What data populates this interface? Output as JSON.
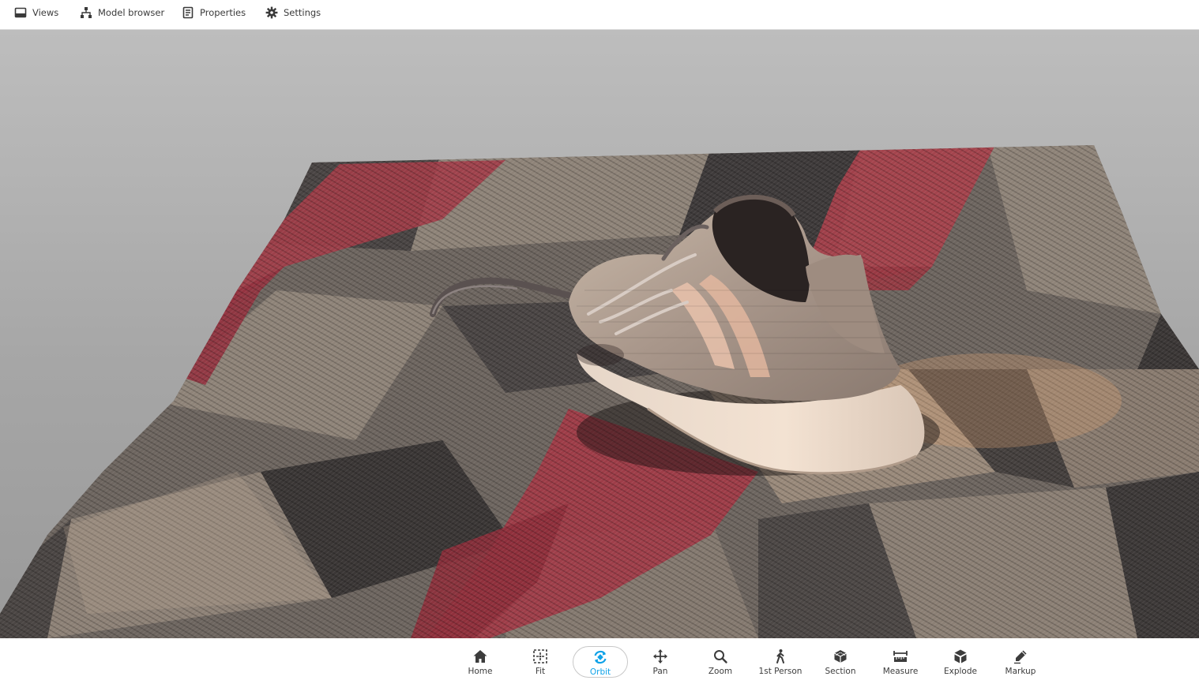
{
  "top_menu": {
    "views": "Views",
    "model_browser": "Model browser",
    "properties": "Properties",
    "settings": "Settings"
  },
  "toolbar": {
    "active_tool": "Orbit",
    "accent_color": "#0fa2e8",
    "icon_color": "#3c3c3c",
    "items": [
      {
        "label": "Home",
        "icon": "home-icon"
      },
      {
        "label": "Fit",
        "icon": "fit-icon"
      },
      {
        "label": "Orbit",
        "icon": "orbit-icon"
      },
      {
        "label": "Pan",
        "icon": "pan-icon"
      },
      {
        "label": "Zoom",
        "icon": "zoom-icon"
      },
      {
        "label": "1st Person",
        "icon": "first-person-icon"
      },
      {
        "label": "Section",
        "icon": "section-icon"
      },
      {
        "label": "Measure",
        "icon": "measure-icon"
      },
      {
        "label": "Explode",
        "icon": "explode-icon"
      },
      {
        "label": "Markup",
        "icon": "markup-icon"
      }
    ]
  },
  "viewer": {
    "background_top": "#bdbdbd",
    "background_bottom": "#9a9a9a"
  }
}
